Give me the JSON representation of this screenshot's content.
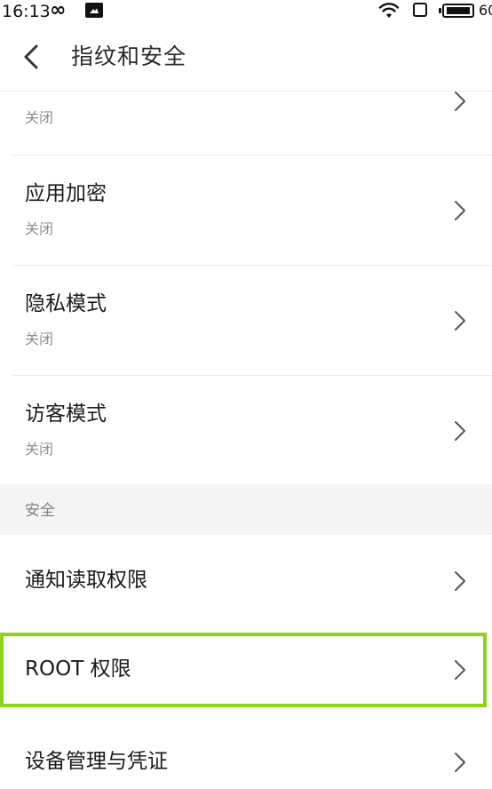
{
  "status_bar": {
    "time": "16:13",
    "infinity_symbol": "∞",
    "battery_text": "60",
    "icons": [
      "infinity-icon",
      "gallery-icon",
      "wifi-icon",
      "square-icon",
      "battery-icon"
    ]
  },
  "header": {
    "title": "指纹和安全",
    "back_icon": "chevron-left-icon"
  },
  "items": [
    {
      "title": "",
      "subtitle": "关闭"
    },
    {
      "title": "应用加密",
      "subtitle": "关闭"
    },
    {
      "title": "隐私模式",
      "subtitle": "关闭"
    },
    {
      "title": "访客模式",
      "subtitle": "关闭"
    }
  ],
  "section_security": {
    "label": "安全",
    "items": [
      {
        "title": "通知读取权限"
      },
      {
        "title": "ROOT 权限",
        "highlighted": true
      },
      {
        "title": "设备管理与凭证"
      }
    ]
  },
  "colors": {
    "highlight": "#8cd319",
    "background": "#f7f7f7",
    "text": "#1a1a1a",
    "subtext": "#8e8e8e"
  }
}
